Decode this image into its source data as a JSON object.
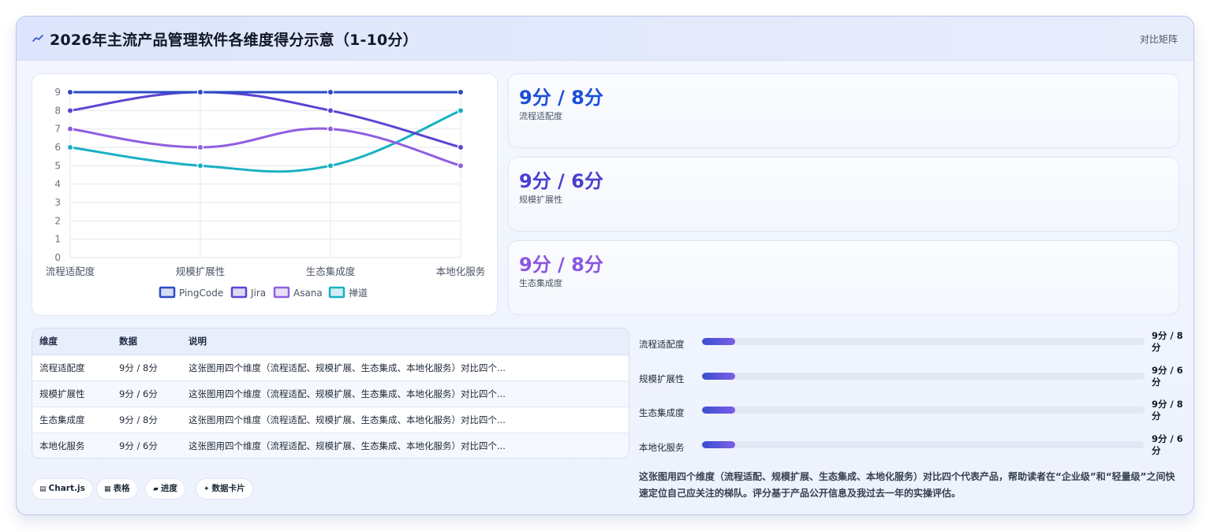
{
  "header": {
    "icon": "chart-line-icon",
    "title": "2026年主流产品管理软件各维度得分示意（1-10分）",
    "link": "对比矩阵"
  },
  "chart_data": {
    "type": "line",
    "categories": [
      "流程适配度",
      "规模扩展性",
      "生态集成度",
      "本地化服务"
    ],
    "series": [
      {
        "name": "PingCode",
        "values": [
          9,
          9,
          9,
          9
        ],
        "color": "#2f4ac6"
      },
      {
        "name": "Jira",
        "values": [
          8,
          9,
          8,
          6
        ],
        "color": "#5a45d3"
      },
      {
        "name": "Asana",
        "values": [
          7,
          6,
          7,
          5
        ],
        "color": "#8f5fe0"
      },
      {
        "name": "禅道",
        "values": [
          6,
          5,
          5,
          8
        ],
        "color": "#19b0c4"
      }
    ],
    "ylim": [
      0,
      9
    ],
    "yticks": [
      0,
      1,
      2,
      3,
      4,
      5,
      6,
      7,
      8,
      9
    ],
    "grid": true,
    "legend": "bottom",
    "smooth": true
  },
  "stats": [
    {
      "value": "9分 / 8分",
      "label": "流程适配度",
      "color": "#1d4fd8"
    },
    {
      "value": "9分 / 6分",
      "label": "规模扩展性",
      "color": "#4a3fd0"
    },
    {
      "value": "9分 / 8分",
      "label": "生态集成度",
      "color": "#8a57de"
    }
  ],
  "table": {
    "headers": [
      "维度",
      "数据",
      "说明"
    ],
    "rows": [
      [
        "流程适配度",
        "9分 / 8分",
        "这张图用四个维度（流程适配、规模扩展、生态集成、本地化服务）对比四个..."
      ],
      [
        "规模扩展性",
        "9分 / 6分",
        "这张图用四个维度（流程适配、规模扩展、生态集成、本地化服务）对比四个..."
      ],
      [
        "生态集成度",
        "9分 / 8分",
        "这张图用四个维度（流程适配、规模扩展、生态集成、本地化服务）对比四个..."
      ],
      [
        "本地化服务",
        "9分 / 6分",
        "这张图用四个维度（流程适配、规模扩展、生态集成、本地化服务）对比四个..."
      ]
    ]
  },
  "progress": [
    {
      "label": "流程适配度",
      "value": "9分 / 8分",
      "fraction": 0.075
    },
    {
      "label": "规模扩展性",
      "value": "9分 / 6分",
      "fraction": 0.075
    },
    {
      "label": "生态集成度",
      "value": "9分 / 8分",
      "fraction": 0.075
    },
    {
      "label": "本地化服务",
      "value": "9分 / 6分",
      "fraction": 0.075
    }
  ],
  "tags": [
    {
      "icon": "chart-icon",
      "glyph": "▤",
      "label": "Chart.js"
    },
    {
      "icon": "table-icon",
      "glyph": "▦",
      "label": "表格"
    },
    {
      "icon": "progress-icon",
      "glyph": "▰",
      "label": "进度"
    },
    {
      "icon": "sparkle-icon",
      "glyph": "✦",
      "label": "数据卡片"
    }
  ],
  "note": "这张图用四个维度（流程适配、规模扩展、生态集成、本地化服务）对比四个代表产品，帮助读者在“企业级”和“轻量级”之间快速定位自己应关注的梯队。评分基于产品公开信息及我过去一年的实操评估。"
}
